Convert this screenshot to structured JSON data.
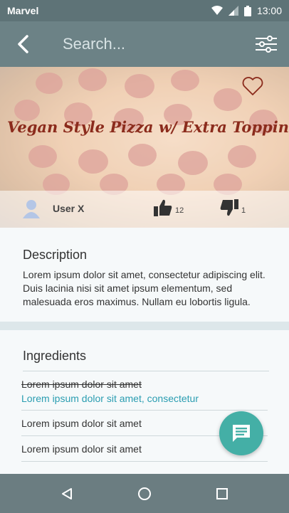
{
  "status": {
    "carrier": "Marvel",
    "time": "13:00"
  },
  "appbar": {
    "search_placeholder": "Search..."
  },
  "recipe": {
    "title": "Vegan Style Pizza w/ Extra Toppings",
    "user": "User X",
    "likes": "12",
    "dislikes": "1"
  },
  "description": {
    "heading": "Description",
    "text": "Lorem ipsum dolor sit amet, consectetur adipiscing elit. Duis lacinia nisi sit amet ipsum elementum, sed malesuada eros maximus. Nullam eu lobortis ligula."
  },
  "ingredients": {
    "heading": "Ingredients",
    "items": [
      "Lorem ipsum dolor sit amet",
      "Lorem ipsum dolor sit amet, consectetur",
      "Lorem ipsum dolor sit amet",
      "Lorem ipsum dolor sit amet"
    ]
  },
  "colors": {
    "accent": "#44afa6",
    "link": "#2a9db1",
    "appbar": "#6c8286",
    "navbar": "#6b7d81"
  },
  "icons": [
    "back-arrow-icon",
    "filter-sliders-icon",
    "heart-icon",
    "user-avatar-icon",
    "thumbs-up-icon",
    "thumbs-down-icon",
    "chat-icon",
    "nav-back-icon",
    "nav-home-icon",
    "nav-recents-icon",
    "wifi-icon",
    "signal-icon",
    "battery-icon"
  ]
}
